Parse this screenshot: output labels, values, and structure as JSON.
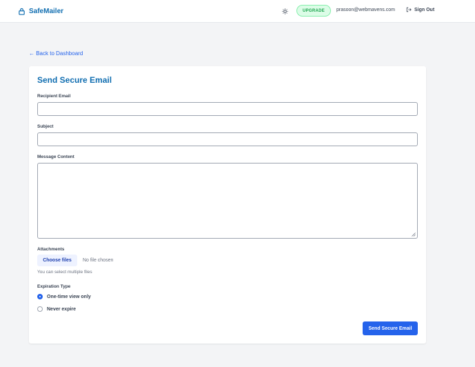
{
  "header": {
    "brand": "SafeMailer",
    "brand_icon": "lock-icon",
    "theme_icon": "sun-icon",
    "upgrade_label": "UPGRADE",
    "user_email": "prasoon@webmavens.com",
    "signout_label": "Sign Out",
    "signout_icon": "sign-out-icon"
  },
  "nav": {
    "back_label": "← Back to Dashboard"
  },
  "form": {
    "title": "Send Secure Email",
    "recipient": {
      "label": "Recipient Email",
      "value": ""
    },
    "subject": {
      "label": "Subject",
      "value": ""
    },
    "message": {
      "label": "Message Content",
      "value": ""
    },
    "attachments": {
      "label": "Attachments",
      "button_label": "Choose files",
      "status": "No file chosen",
      "hint": "You can select multiple files"
    },
    "expiration": {
      "label": "Expiration Type",
      "options": [
        {
          "label": "One-time view only",
          "selected": true
        },
        {
          "label": "Never expire",
          "selected": false
        }
      ]
    },
    "submit_label": "Send Secure Email"
  },
  "colors": {
    "brand": "#0f6db0",
    "primary": "#2563eb",
    "upgrade_bg": "#dcfce7",
    "upgrade_text": "#16a34a",
    "page_bg": "#f3f4f6"
  }
}
